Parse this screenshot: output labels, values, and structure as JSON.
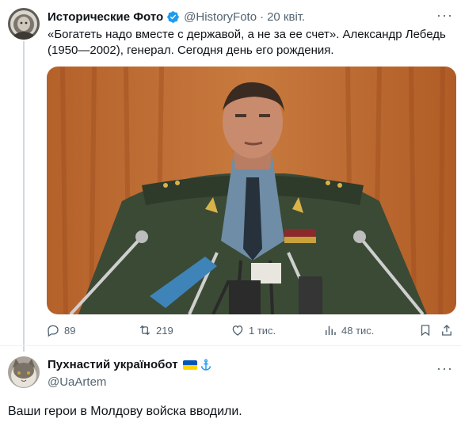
{
  "tweet": {
    "author_name": "Исторические Фото",
    "handle": "@HistoryFoto",
    "separator": "·",
    "date": "20 квіт.",
    "text": "«Богатеть надо вместе с державой, а не за ее счет». Александр Лебедь\n(1950—2002), генерал. Сегодня день его рождения.",
    "actions": {
      "replies": "89",
      "retweets": "219",
      "likes": "1 тис.",
      "views": "48 тис."
    }
  },
  "reply": {
    "author_name": "Пухнастий українобот",
    "handle": "@UaArtem",
    "text": "Ваши герои в Молдову войска вводили."
  },
  "colors": {
    "verified": "#1d9bf0",
    "muted": "#536471",
    "text": "#0f1419",
    "flag_blue": "#0057b7",
    "flag_yellow": "#ffd700",
    "anchor": "#1d9bf0"
  },
  "icons": [
    "verified-badge-icon",
    "reply-icon",
    "retweet-icon",
    "like-icon",
    "views-icon",
    "bookmark-icon",
    "share-icon",
    "ukraine-flag-icon",
    "anchor-icon",
    "more-icon"
  ]
}
